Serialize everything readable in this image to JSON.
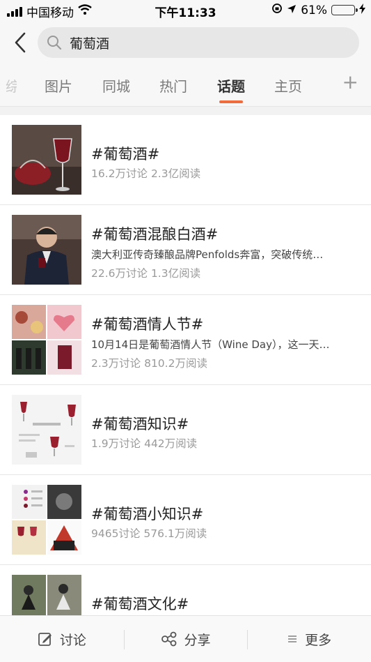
{
  "status_bar": {
    "carrier": "中国移动",
    "time": "下午11:33",
    "battery": "61%",
    "battery_level": 0.61
  },
  "search": {
    "query": "葡萄酒"
  },
  "tabs": [
    {
      "label": "综",
      "active": false
    },
    {
      "label": "图片",
      "active": false
    },
    {
      "label": "同城",
      "active": false
    },
    {
      "label": "热门",
      "active": false
    },
    {
      "label": "话题",
      "active": true
    },
    {
      "label": "主页",
      "active": false
    }
  ],
  "topics": [
    {
      "title": "#葡萄酒#",
      "desc": "",
      "stats": "16.2万讨论 2.3亿阅读"
    },
    {
      "title": "#葡萄酒混酿白酒#",
      "desc": "澳大利亚传奇臻酿品牌Penfolds奔富，突破传统…",
      "stats": "22.6万讨论 1.3亿阅读"
    },
    {
      "title": "#葡萄酒情人节#",
      "desc": "10月14日是葡萄酒情人节（Wine Day），这一天…",
      "stats": "2.3万讨论 810.2万阅读"
    },
    {
      "title": "#葡萄酒知识#",
      "desc": "",
      "stats": "1.9万讨论 442万阅读"
    },
    {
      "title": "#葡萄酒小知识#",
      "desc": "",
      "stats": "9465讨论 576.1万阅读"
    },
    {
      "title": "#葡萄酒文化#",
      "desc": "",
      "stats": ""
    }
  ],
  "bottom_bar": {
    "discuss": "讨论",
    "share": "分享",
    "more": "更多"
  },
  "colors": {
    "accent": "#f26b3a",
    "battery": "#f2c318"
  }
}
